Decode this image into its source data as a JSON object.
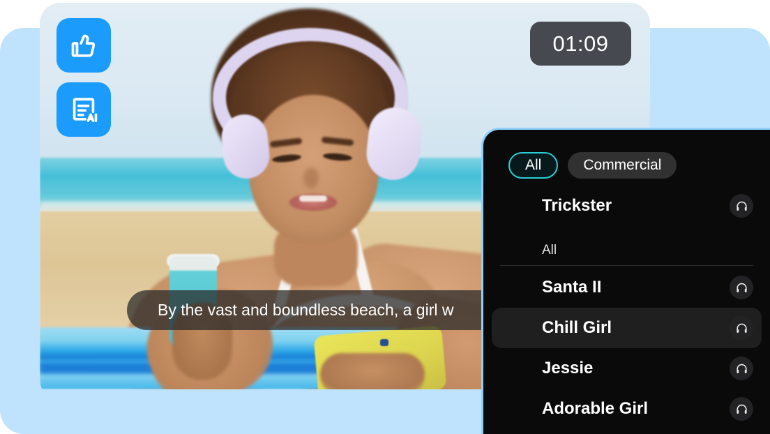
{
  "overlay_buttons": [
    {
      "name": "like-button",
      "icon": "thumbs-up-icon",
      "label": "Like"
    },
    {
      "name": "ai-script-button",
      "icon": "ai-script-icon",
      "label": "AI Script"
    }
  ],
  "timer": {
    "value": "01:09"
  },
  "caption": {
    "text": "By the vast and boundless beach, a girl w"
  },
  "voice_panel": {
    "filters": [
      {
        "label": "All",
        "active": true
      },
      {
        "label": "Commercial",
        "active": false
      }
    ],
    "current_voice": {
      "name": "Trickster",
      "preview_icon": "headphones-icon"
    },
    "section_label": "All",
    "voices": [
      {
        "name": "Santa II",
        "selected": false,
        "preview_icon": "headphones-icon"
      },
      {
        "name": "Chill Girl",
        "selected": true,
        "preview_icon": "headphones-icon"
      },
      {
        "name": "Jessie",
        "selected": false,
        "preview_icon": "headphones-icon"
      },
      {
        "name": "Adorable Girl",
        "selected": false,
        "preview_icon": "headphones-icon"
      }
    ]
  },
  "colors": {
    "accent_blue": "#1b9cfc",
    "backdrop_blue": "#c0e3fd",
    "panel_bg": "#0a0a0a",
    "panel_border": "#8fd0fb",
    "chip_active_border": "#27cfd4",
    "chip_idle_bg": "#313131",
    "row_selected_bg": "#1f1f1f",
    "timer_bg": "#464a50"
  }
}
